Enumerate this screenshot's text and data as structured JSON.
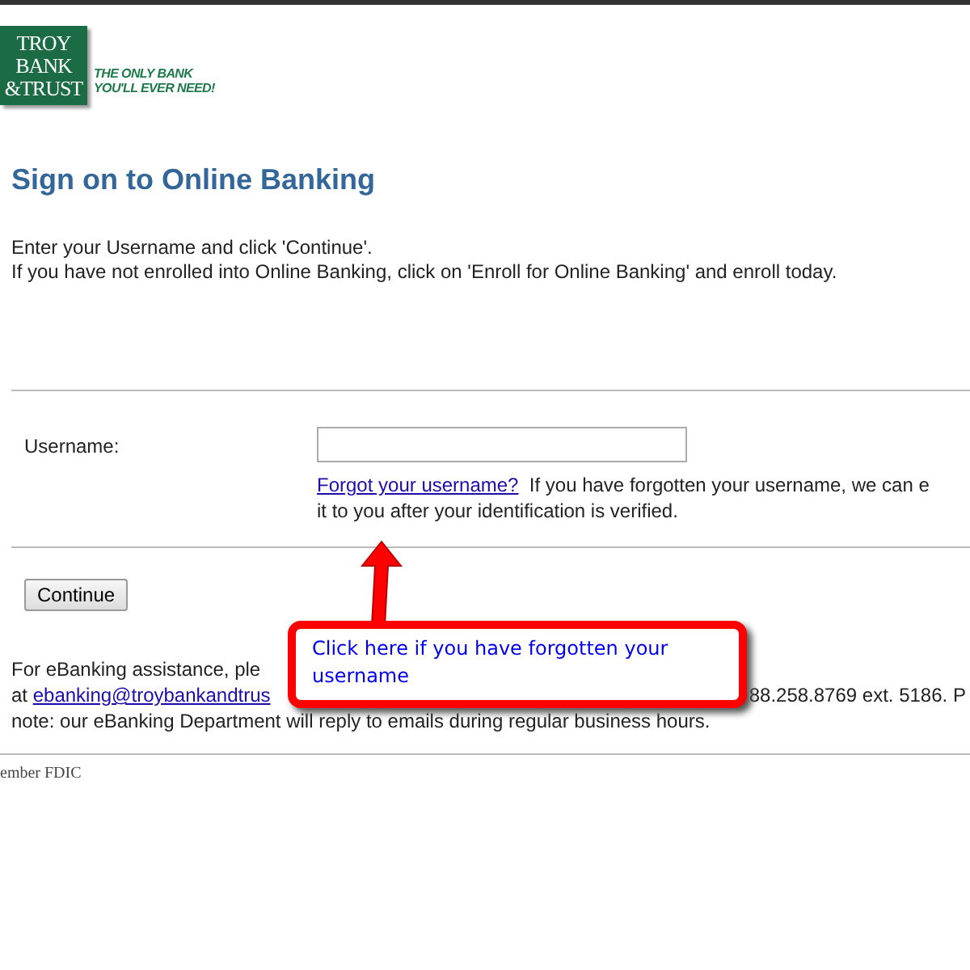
{
  "logo": {
    "lines": [
      "TROY",
      "BANK",
      "&TRUST"
    ],
    "tagline": [
      "THE ONLY BANK",
      "YOU'LL EVER NEED!"
    ]
  },
  "title": "Sign on to Online Banking",
  "intro": [
    "Enter your Username and click 'Continue'.",
    "If you have not enrolled into Online Banking, click on 'Enroll for Online Banking' and enroll today."
  ],
  "username": {
    "label": "Username:",
    "forgot_link": "Forgot your username?",
    "forgot_text": "If you have forgotten your username, we can e",
    "forgot_text_2": "it to you after your identification is verified."
  },
  "continue_button": "Continue",
  "help": {
    "line_1": "For eBanking assistance, ple",
    "line_2_prefix": "at",
    "email": "ebanking@troybankandtrus",
    "line_2_suffix": "88.258.8769 ext. 5186. P",
    "line_3": "note: our eBanking Department will reply to emails during regular business hours."
  },
  "footer": "ember FDIC",
  "callout": {
    "text": "Click here if you have forgotten your username"
  }
}
